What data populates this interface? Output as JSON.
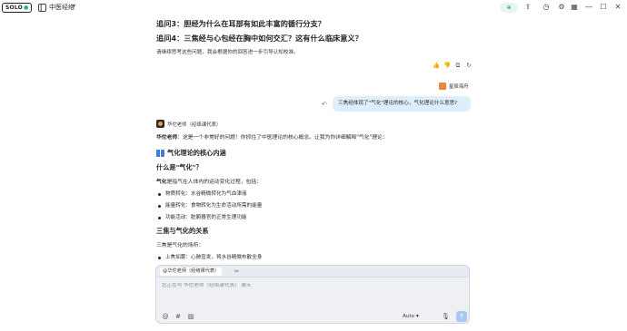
{
  "topbar": {
    "solo_label": "SOLO",
    "doc_title": "中医经络",
    "status_badge": "⊕",
    "icons": [
      "sidebar-toggle-icon",
      "chevron-down-icon",
      "share-icon",
      "history-icon",
      "settings-icon",
      "grid-icon",
      "minimize-icon",
      "maximize-icon",
      "close-icon"
    ]
  },
  "conversation": {
    "question3": "追问3：胆经为什么在耳部有如此丰富的循行分支？",
    "question4": "追问4：三焦经与心包经在胸中如何交汇？这有什么临床意义？",
    "prompt": "请继续思考这些问题，我会根据你的回答进一步引导认知校准。",
    "user_name": "星辰海舟",
    "user_message": "三焦经体现了\"气化\"理论的核心，气化理论什么意思?",
    "ai_name": "华佗老师（经络课代表）",
    "ai_intro_bold": "华佗老师",
    "ai_intro_rest": "：这是一个非常好的问题！你抓住了中医理论的核心概念。让我为你详细解释\"气化\"理论：",
    "heading_core": "气化理论的核心内涵",
    "heading_what": "什么是\"气化\"？",
    "definition_bold": "气化",
    "definition_rest": "是指气在人体内的运动变化过程，包括：",
    "bullets": [
      "物质转化：水谷精微转化为气血津液",
      "能量转化：食物转化为生命活动所需的能量",
      "功能活动：脏腑器官的正常生理功能"
    ],
    "heading_sanjiao": "三焦与气化的关系",
    "sanjiao_text": "三焦是气化的场所：",
    "cutoff_item": "上焦如雾：心肺宣发，将水谷精微布散全身"
  },
  "composer": {
    "mention": "@华佗老师（经络课代表）",
    "placeholder": "您正在与 华佗老师（经络课代表） 聊天",
    "model": "Auto"
  },
  "colors": {
    "accent": "#a9c8f3",
    "user_bubble": "#dfeefb",
    "composer_bg": "#eef0f3"
  }
}
